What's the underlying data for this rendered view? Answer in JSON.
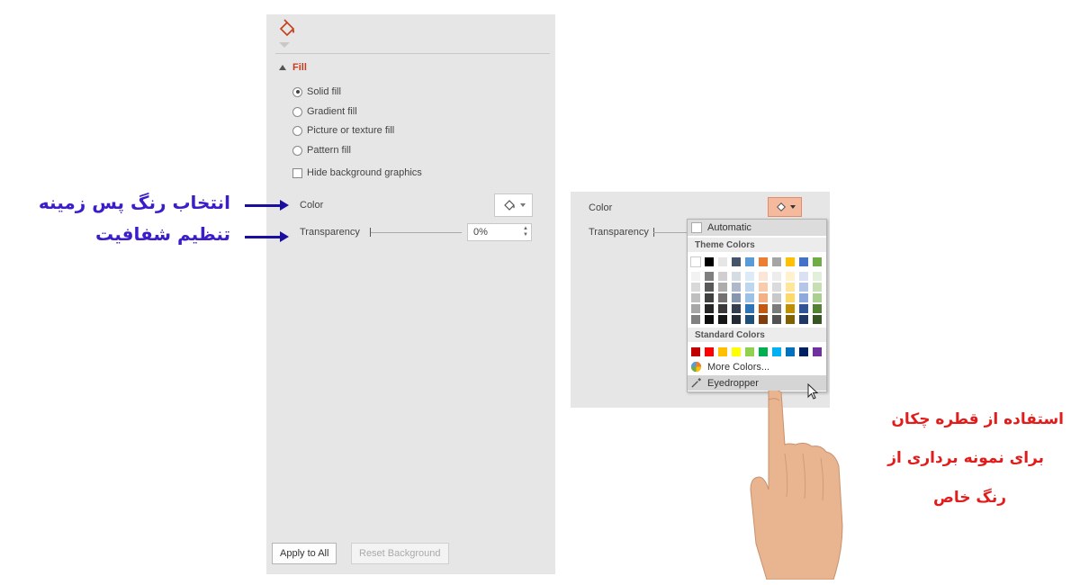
{
  "format_pane": {
    "icon": "fill-bucket-icon",
    "section_title": "Fill",
    "fill_options": [
      {
        "label": "Solid fill",
        "selected": true
      },
      {
        "label": "Gradient fill",
        "selected": false
      },
      {
        "label": "Picture or texture fill",
        "selected": false
      },
      {
        "label": "Pattern fill",
        "selected": false
      }
    ],
    "hide_graphics_label": "Hide background graphics",
    "hide_graphics_checked": false,
    "color_label": "Color",
    "transparency_label": "Transparency",
    "transparency_value": "0%",
    "apply_all_label": "Apply to All",
    "reset_label": "Reset Background"
  },
  "annotations": {
    "choose_bg_color": "انتخاب رنگ پس زمینه",
    "set_transparency": "تنظیم شفافیت",
    "eyedropper_line1": "استفاده از قطره چکان",
    "eyedropper_line2": "برای نمونه برداری از",
    "eyedropper_line3": "رنگ  خاص"
  },
  "color_menu": {
    "color_label": "Color",
    "transparency_label": "Transparency",
    "automatic_label": "Automatic",
    "theme_colors_label": "Theme Colors",
    "standard_colors_label": "Standard Colors",
    "more_colors_label": "More Colors...",
    "eyedropper_label": "Eyedropper",
    "theme_base": [
      "#ffffff",
      "#000000",
      "#e7e6e6",
      "#44546a",
      "#5b9bd5",
      "#ed7d31",
      "#a5a5a5",
      "#ffc000",
      "#4472c4",
      "#70ad47"
    ],
    "theme_shades": [
      [
        "#f2f2f2",
        "#d9d9d9",
        "#bfbfbf",
        "#a6a6a6",
        "#808080"
      ],
      [
        "#7f7f7f",
        "#595959",
        "#404040",
        "#262626",
        "#0d0d0d"
      ],
      [
        "#d0cece",
        "#aeabab",
        "#757171",
        "#3a3838",
        "#171616"
      ],
      [
        "#d6dce4",
        "#adb9ca",
        "#8496b0",
        "#333f4f",
        "#222a35"
      ],
      [
        "#ddebf7",
        "#bdd7ee",
        "#9bc2e6",
        "#2f75b5",
        "#1f4e78"
      ],
      [
        "#fce4d6",
        "#f8cbad",
        "#f4b084",
        "#c65911",
        "#833c0c"
      ],
      [
        "#ededed",
        "#dbdbdb",
        "#c9c9c9",
        "#7b7b7b",
        "#525252"
      ],
      [
        "#fff2cc",
        "#ffe699",
        "#ffd966",
        "#bf8f00",
        "#806000"
      ],
      [
        "#d9e1f2",
        "#b4c6e7",
        "#8ea9db",
        "#305496",
        "#203764"
      ],
      [
        "#e2efda",
        "#c6e0b4",
        "#a9d08e",
        "#548235",
        "#375623"
      ]
    ],
    "standard": [
      "#c00000",
      "#ff0000",
      "#ffc000",
      "#ffff00",
      "#92d050",
      "#00b050",
      "#00b0f0",
      "#0070c0",
      "#002060",
      "#7030a0"
    ]
  }
}
